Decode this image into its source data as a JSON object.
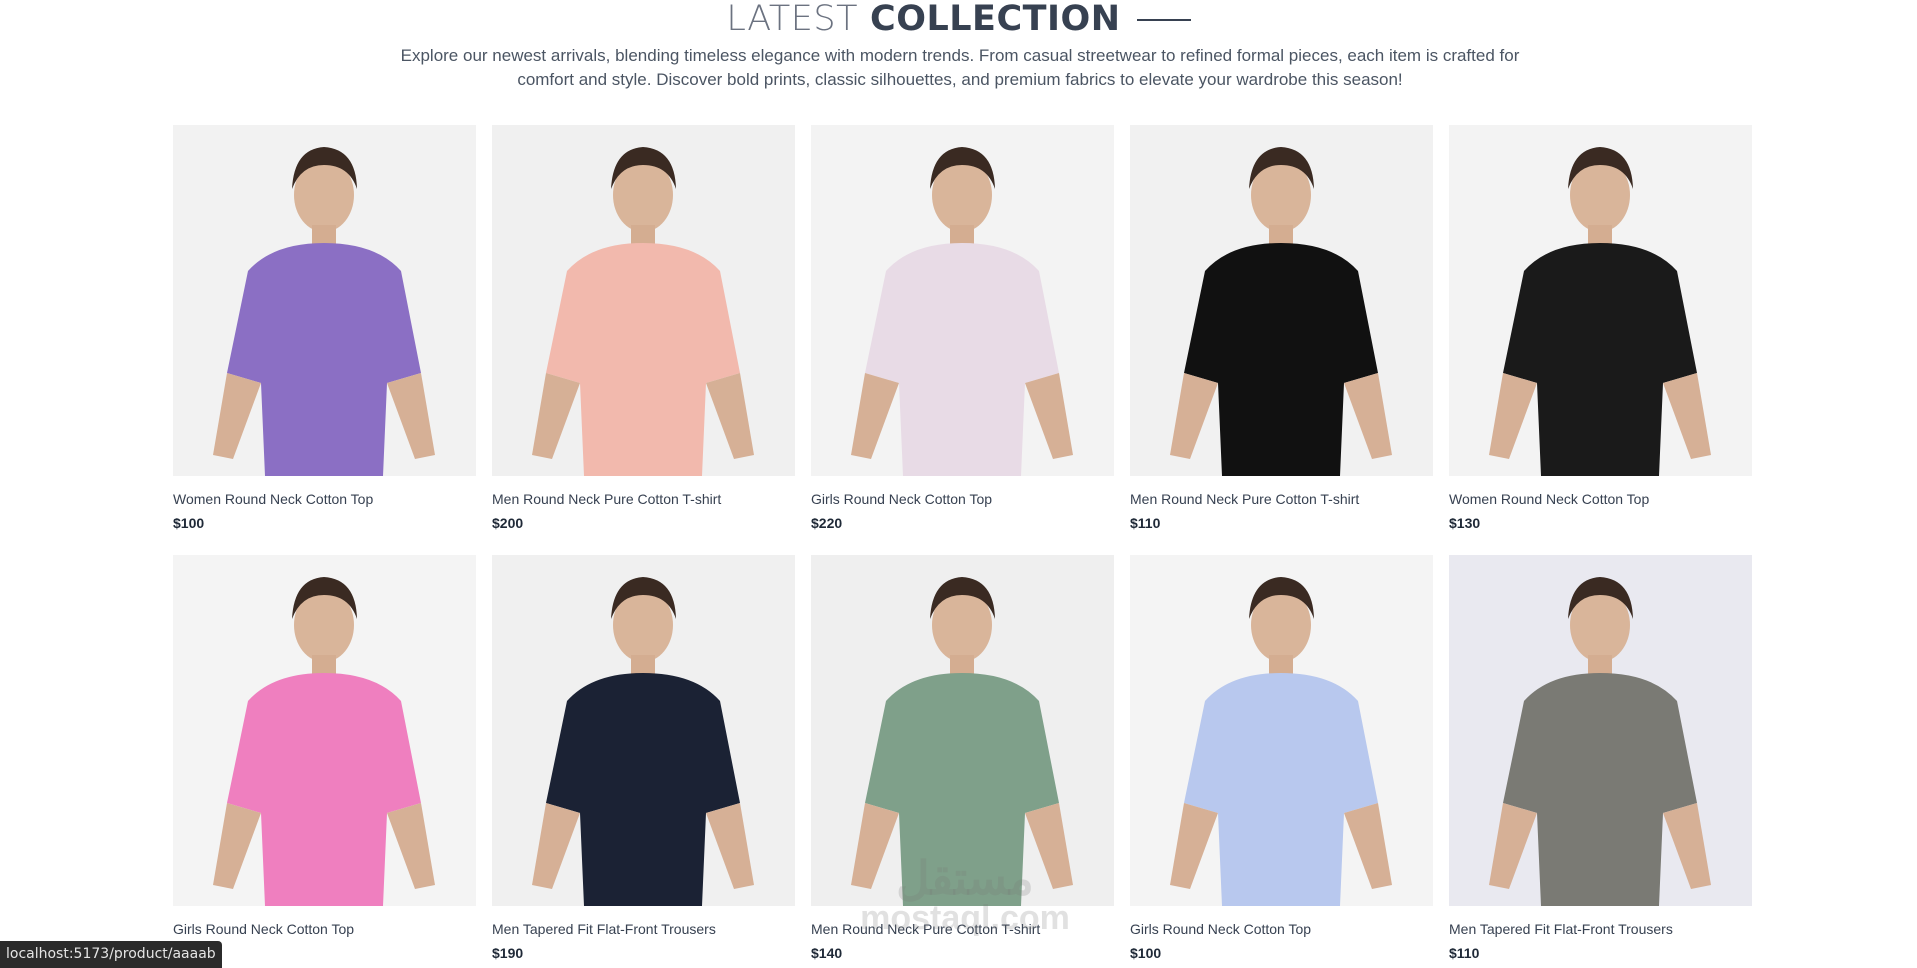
{
  "section": {
    "title_light": "LATEST",
    "title_strong": "COLLECTION",
    "description": "Explore our newest arrivals, blending timeless elegance with modern trends. From casual streetwear to refined formal pieces, each item is crafted for comfort and style. Discover bold prints, classic silhouettes, and premium fabrics to elevate your wardrobe this season!"
  },
  "products": [
    {
      "name": "Women Round Neck Cotton Top",
      "price": "$100",
      "image": "floral-off-shoulder-top-photo",
      "accent": "#8b6fc4",
      "bg": "#f2f2f2"
    },
    {
      "name": "Men Round Neck Pure Cotton T-shirt",
      "price": "$200",
      "image": "pink-polo-shirt-photo",
      "accent": "#f2b9ad",
      "bg": "#f0f0f0"
    },
    {
      "name": "Girls Round Neck Cotton Top",
      "price": "$220",
      "image": "girl-floral-dress-photo",
      "accent": "#e8dbe6",
      "bg": "#f3f3f3"
    },
    {
      "name": "Men Round Neck Pure Cotton T-shirt",
      "price": "$110",
      "image": "black-puma-tshirt-photo",
      "accent": "#111111",
      "bg": "#f1f1f1"
    },
    {
      "name": "Women Round Neck Cotton Top",
      "price": "$130",
      "image": "black-puma-tee-woman-photo",
      "accent": "#1a1a1a",
      "bg": "#f3f3f3"
    },
    {
      "name": "Girls Round Neck Cotton Top",
      "price": "",
      "image": "girl-pink-top-photo",
      "accent": "#ef7fbf",
      "bg": "#f4f4f4"
    },
    {
      "name": "Men Tapered Fit Flat-Front Trousers",
      "price": "$190",
      "image": "navy-trousers-photo",
      "accent": "#1b2234",
      "bg": "#f0f0f0"
    },
    {
      "name": "Men Round Neck Pure Cotton T-shirt",
      "price": "$140",
      "image": "striped-rugby-sweatshirt-photo",
      "accent": "#7fa08a",
      "bg": "#efefef"
    },
    {
      "name": "Girls Round Neck Cotton Top",
      "price": "$100",
      "image": "girl-blue-top-photo",
      "accent": "#b8c8ee",
      "bg": "#f4f4f4"
    },
    {
      "name": "Men Tapered Fit Flat-Front Trousers",
      "price": "$110",
      "image": "grey-cargo-joggers-photo",
      "accent": "#7a7a74",
      "bg": "#e9e9f0"
    }
  ],
  "statusbar": {
    "url": "localhost:5173/product/aaaab"
  },
  "watermark": {
    "arabic": "مستقل",
    "latin": "mostaql.com"
  }
}
